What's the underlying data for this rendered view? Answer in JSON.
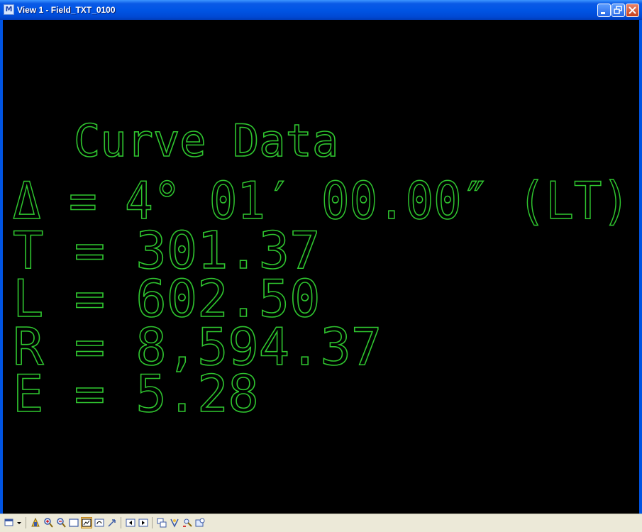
{
  "window": {
    "title": "View 1 - Field_TXT_0100",
    "app_icon": "M",
    "controls": [
      "minimize-icon",
      "maximize-icon",
      "close-icon"
    ]
  },
  "drawing": {
    "heading": "Curve Data",
    "lines": [
      "Δ = 4° 01′ 00.00″ (LT)",
      "T = 301.37",
      "L = 602.50",
      "R = 8,594.37",
      "E = 5.28"
    ],
    "text_color": "#2fc52f",
    "background_color": "#000000"
  },
  "toolbar": {
    "tools": [
      "view-attributes-icon",
      "dropdown-icon",
      "update-view-icon",
      "zoom-in-icon",
      "zoom-out-icon",
      "window-area-icon",
      "fit-view-icon",
      "rotate-view-icon",
      "pan-view-icon",
      "view-previous-icon",
      "view-next-icon",
      "copy-view-icon",
      "change-view-perspective-icon",
      "camera-icon",
      "clip-volume-icon"
    ]
  }
}
